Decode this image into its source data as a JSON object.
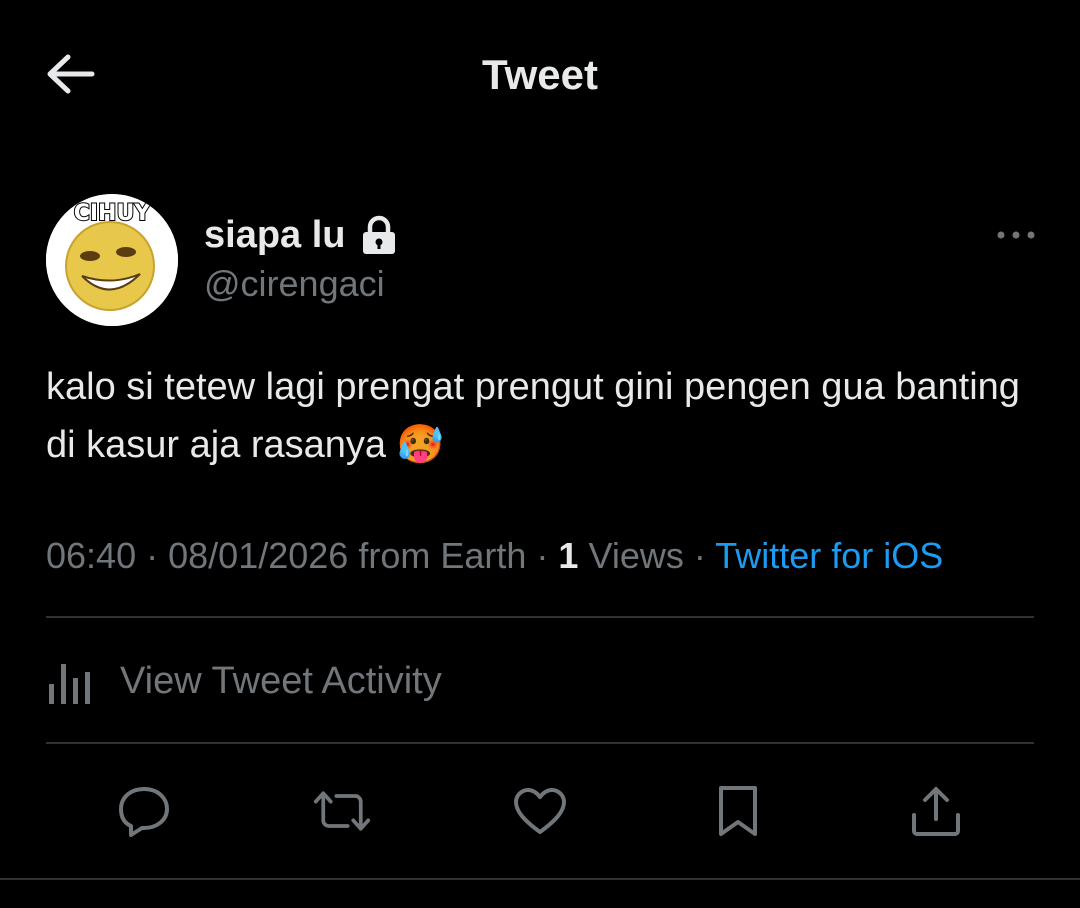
{
  "header": {
    "title": "Tweet",
    "back_icon": "arrow-left-icon"
  },
  "author": {
    "avatar_caption": "CIHUY",
    "display_name": "siapa lu",
    "handle": "@cirengaci",
    "protected_icon": "lock-icon"
  },
  "tweet": {
    "text": "kalo si tetew lagi prengat prengut gini pengen gua banting di kasur aja rasanya 🥵"
  },
  "meta": {
    "time": "06:40",
    "date": "08/01/2026",
    "location": "from Earth",
    "views_count": "1",
    "views_label": "Views",
    "source": "Twitter for iOS",
    "separator": "·"
  },
  "activity": {
    "label": "View Tweet Activity",
    "icon": "analytics-icon"
  },
  "actions": {
    "icons": [
      "reply-icon",
      "retweet-icon",
      "like-icon",
      "bookmark-icon",
      "share-icon"
    ]
  },
  "colors": {
    "background": "#000000",
    "text": "#e7e9ea",
    "secondary": "#71767b",
    "accent": "#1d9bf0",
    "divider": "#2f3336"
  }
}
